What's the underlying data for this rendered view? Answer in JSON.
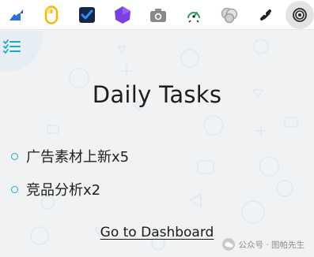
{
  "toolbar": {
    "icons": [
      {
        "name": "trend-chart-icon",
        "color": "#1e5fb4"
      },
      {
        "name": "mouse-icon",
        "color": "#f7b500"
      },
      {
        "name": "checkbox-icon",
        "color": "#1b2a4a"
      },
      {
        "name": "hexagon-icon",
        "color": "#7b3fe4"
      },
      {
        "name": "camera-icon",
        "color": "#8a8a8a"
      },
      {
        "name": "speedometer-icon",
        "color": "#2e9d5a"
      },
      {
        "name": "bubbles-icon",
        "color": "#9a9a9a"
      },
      {
        "name": "link-icon",
        "color": "#222222"
      },
      {
        "name": "target-icon",
        "color": "#2b2b2b"
      }
    ]
  },
  "page": {
    "title": "Daily Tasks",
    "tasks": [
      "广告素材上新x5",
      "竞品分析x2"
    ],
    "dashboard_link": "Go to Dashboard",
    "accent_color": "#1aa8c6"
  },
  "watermark": {
    "text": "公众号 · 图帕先生"
  }
}
